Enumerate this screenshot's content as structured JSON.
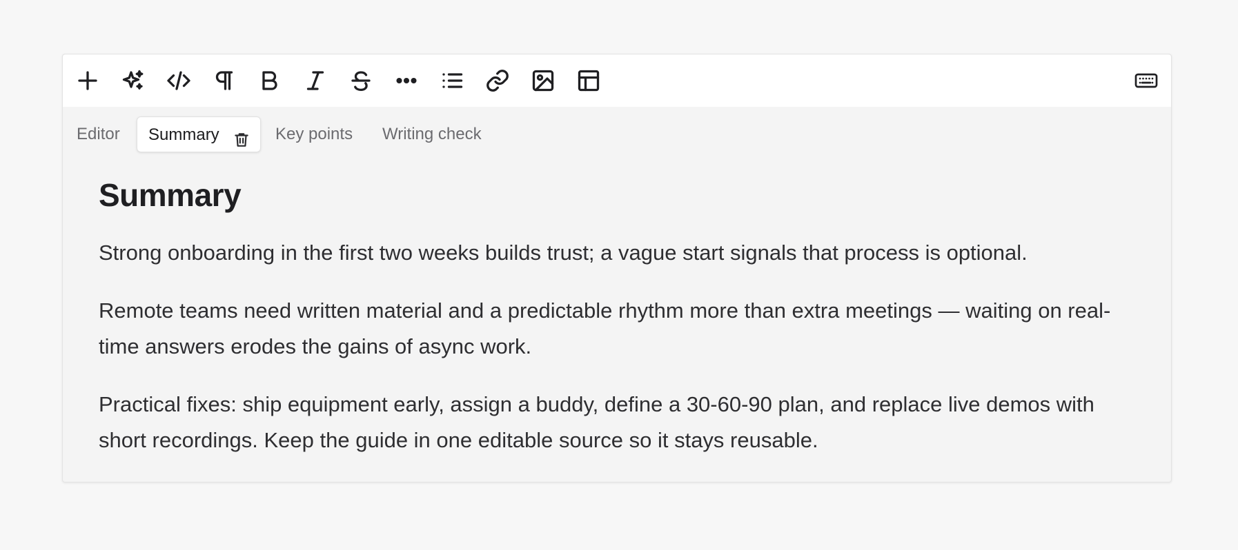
{
  "toolbar": {
    "tools": [
      {
        "name": "add",
        "icon": "plus-icon"
      },
      {
        "name": "ai",
        "icon": "sparkles-icon"
      },
      {
        "name": "code",
        "icon": "code-icon"
      },
      {
        "name": "paragraph",
        "icon": "pilcrow-icon"
      },
      {
        "name": "bold",
        "icon": "bold-icon"
      },
      {
        "name": "italic",
        "icon": "italic-icon"
      },
      {
        "name": "strikethrough",
        "icon": "strikethrough-icon"
      },
      {
        "name": "more",
        "icon": "ellipsis-icon"
      },
      {
        "name": "list",
        "icon": "list-icon"
      },
      {
        "name": "link",
        "icon": "link-icon"
      },
      {
        "name": "image",
        "icon": "image-icon"
      },
      {
        "name": "table",
        "icon": "table-icon"
      },
      {
        "name": "keyboard",
        "icon": "keyboard-icon"
      }
    ]
  },
  "tabs": [
    {
      "label": "Editor",
      "active": false
    },
    {
      "label": "Summary",
      "active": true,
      "delete_icon": "trash-icon"
    },
    {
      "label": "Key points",
      "active": false
    },
    {
      "label": "Writing check",
      "active": false
    }
  ],
  "document": {
    "heading": "Summary",
    "paragraphs": [
      "Strong onboarding in the first two weeks builds trust; a vague start signals that process is optional.",
      "Remote teams need written material and a predictable rhythm more than extra meetings — waiting on real-time answers erodes the gains of async work.",
      "Practical fixes: ship equipment early, assign a buddy, define a 30-60-90 plan, and replace live demos with short recordings. Keep the guide in one editable source so it stays reusable."
    ]
  },
  "colors": {
    "page_background": "#f7f7f7",
    "card_background": "#f4f4f4",
    "toolbar_background": "#ffffff",
    "text": "#2e2e31",
    "muted_tab_text": "#6b6b6f"
  }
}
